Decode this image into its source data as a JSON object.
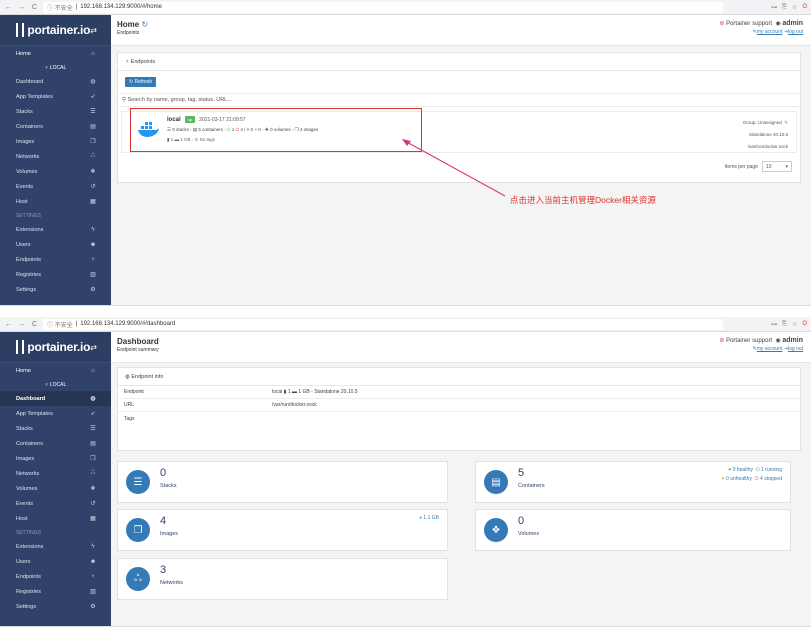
{
  "browser": {
    "nav_back": "←",
    "nav_forward": "→",
    "nav_reload": "C",
    "security": "ⓘ 不安全",
    "url1": "192.168.134.129:9000/#/home",
    "url2": "192.168.134.129:9000/#/dashboard",
    "icons": [
      "key-icon",
      "translate-icon",
      "star-icon",
      "opera-icon"
    ]
  },
  "sidebar": {
    "brand": "portainer.io",
    "home_label": "Home",
    "endpoint_label": "LOCAL",
    "items": [
      {
        "label": "Dashboard",
        "icon": "tachometer-icon",
        "glyph": "◍"
      },
      {
        "label": "App Templates",
        "icon": "rocket-icon",
        "glyph": "➶"
      },
      {
        "label": "Stacks",
        "icon": "th-list-icon",
        "glyph": "☰"
      },
      {
        "label": "Containers",
        "icon": "server-icon",
        "glyph": "▤"
      },
      {
        "label": "Images",
        "icon": "clone-icon",
        "glyph": "❐"
      },
      {
        "label": "Networks",
        "icon": "sitemap-icon",
        "glyph": "ஃ"
      },
      {
        "label": "Volumes",
        "icon": "cubes-icon",
        "glyph": "❖"
      },
      {
        "label": "Events",
        "icon": "history-icon",
        "glyph": "↺"
      },
      {
        "label": "Host",
        "icon": "th-icon",
        "glyph": "▦"
      }
    ],
    "settings_heading": "SETTINGS",
    "settings_items": [
      {
        "label": "Extensions",
        "icon": "bolt-icon",
        "glyph": "ϟ"
      },
      {
        "label": "Users",
        "icon": "users-icon",
        "glyph": "☻"
      },
      {
        "label": "Endpoints",
        "icon": "plug-icon",
        "glyph": "♆"
      },
      {
        "label": "Registries",
        "icon": "database-icon",
        "glyph": "▥"
      },
      {
        "label": "Settings",
        "icon": "cogs-icon",
        "glyph": "⚙"
      }
    ]
  },
  "header": {
    "support": "Portainer support",
    "user": "admin",
    "my_account": "my account",
    "logout": "log out"
  },
  "home": {
    "title": "Home",
    "subtitle": "Endpoints",
    "panel_title": "Endpoints",
    "refresh_label": "Refresh",
    "search_placeholder": "Search by name, group, tag, status, URL...",
    "endpoint": {
      "name": "local",
      "status": "up",
      "date": "2021-03-17 21:09:57",
      "stacks": "0 stacks",
      "containers": "5 containers",
      "running": "1",
      "stopped": "4",
      "healthy": "0",
      "unhealthy": "0",
      "volumes": "0 volumes",
      "images": "4 images",
      "cpu": "1",
      "memory": "1 GB",
      "tags": "No tags",
      "group": "Group: Unassigned",
      "type": "Standalone 20.10.5",
      "socket": "/var/run/docker.sock"
    },
    "items_per_page_label": "Items per page",
    "items_per_page_value": "10"
  },
  "annotation": "点击进入当前主机管理Docker相关资源",
  "dashboard": {
    "title": "Dashboard",
    "subtitle": "Endpoint summary",
    "info_title": "Endpoint info",
    "rows": [
      {
        "k": "Endpoint",
        "v": "local  ▮ 1  ▬ 1 GB - Standalone 20.10.5"
      },
      {
        "k": "URL",
        "v": "/var/run/docker.sock"
      },
      {
        "k": "Tags",
        "v": ""
      }
    ],
    "widgets": {
      "stacks": {
        "value": "0",
        "label": "Stacks"
      },
      "containers": {
        "value": "5",
        "label": "Containers",
        "healthy": "0 healthy",
        "running": "1 running",
        "unhealthy": "0 unhealthy",
        "stopped": "4 stopped"
      },
      "images": {
        "value": "4",
        "label": "Images",
        "size": "1.1 GB"
      },
      "volumes": {
        "value": "0",
        "label": "Volumes"
      },
      "networks": {
        "value": "3",
        "label": "Networks"
      }
    }
  },
  "colors": {
    "sidebar": "#30426a",
    "accent": "#337ab7",
    "up": "#5cb85c",
    "annotation": "#e0302a"
  }
}
